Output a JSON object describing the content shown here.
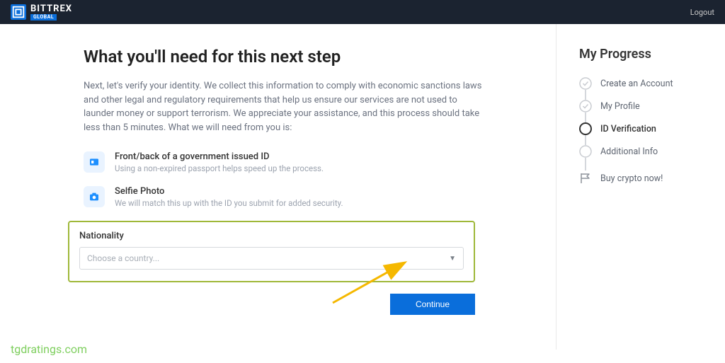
{
  "header": {
    "brand_main": "BITTREX",
    "brand_sub": "GLOBAL",
    "logout": "Logout"
  },
  "main": {
    "heading": "What you'll need for this next step",
    "intro": "Next, let's verify your identity. We collect this information to comply with economic sanctions laws and other legal and regulatory requirements that help us ensure our services are not used to launder money or support terrorism. We appreciate your assistance, and this process should take less than 5 minutes. What we will need from you is:",
    "req1_title": "Front/back of a government issued ID",
    "req1_desc": "Using a non-expired passport helps speed up the process.",
    "req2_title": "Selfie Photo",
    "req2_desc": "We will match this up with the ID you submit for added security.",
    "nat_label": "Nationality",
    "nat_placeholder": "Choose a country...",
    "continue": "Continue"
  },
  "sidebar": {
    "title": "My Progress",
    "steps": [
      {
        "label": "Create an Account"
      },
      {
        "label": "My Profile"
      },
      {
        "label": "ID Verification"
      },
      {
        "label": "Additional Info"
      },
      {
        "label": "Buy crypto now!"
      }
    ]
  },
  "watermark": "tgdratings.com"
}
